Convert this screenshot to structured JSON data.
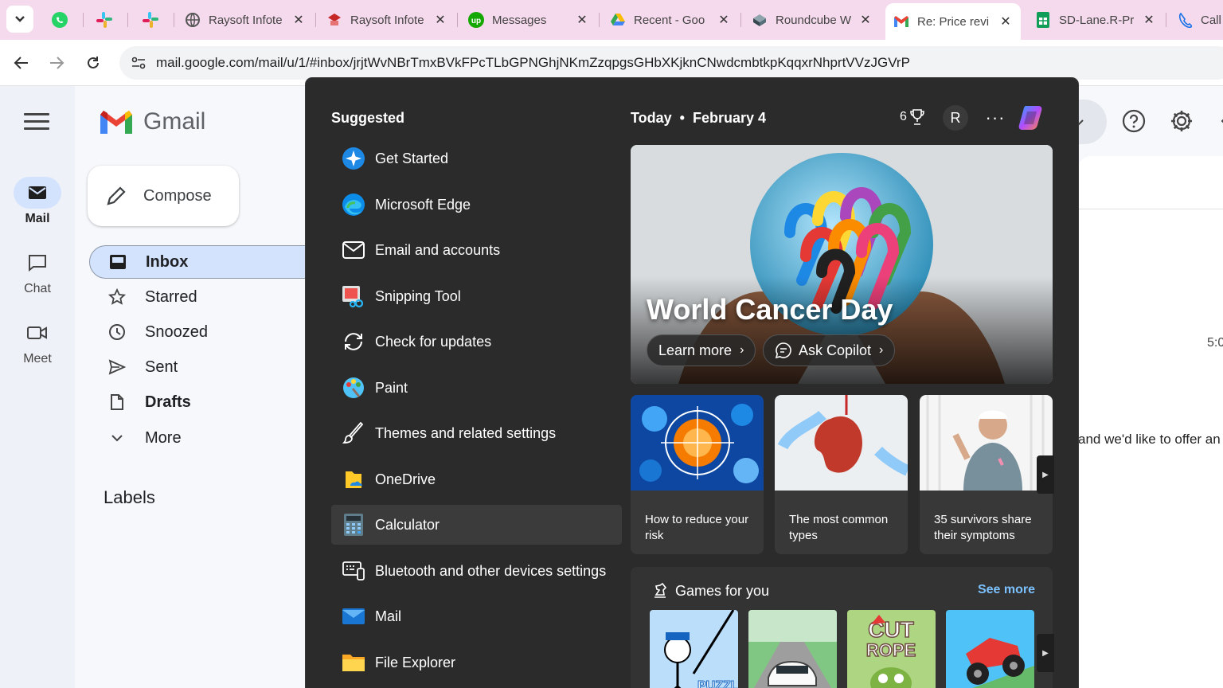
{
  "browser": {
    "tabs": [
      {
        "title": "Raysoft Infote",
        "icon": "globe-icon"
      },
      {
        "title": "Raysoft Infote",
        "icon": "raysoft-icon"
      },
      {
        "title": "Messages",
        "icon": "upwork-icon"
      },
      {
        "title": "Recent - Goo",
        "icon": "google-drive-icon"
      },
      {
        "title": "Roundcube W",
        "icon": "roundcube-icon"
      },
      {
        "title": "Re: Price revi",
        "icon": "gmail-icon",
        "active": true
      },
      {
        "title": "SD-Lane.R-Pr",
        "icon": "google-sheets-icon"
      },
      {
        "title": "Call",
        "icon": "phone-icon"
      }
    ],
    "pinned": [
      "whatsapp-icon",
      "slack-icon",
      "slack-icon"
    ],
    "url": "mail.google.com/mail/u/1/#inbox/jrjtWvNBrTmxBVkFPcTLbGPNGhjNKmZzqpgsGHbXKjknCNwdcmbtkpKqqxrNhprtVVzJGVrP"
  },
  "gmail": {
    "brand": "Gmail",
    "rail": [
      {
        "label": "Mail",
        "icon": "mail-icon",
        "active": true
      },
      {
        "label": "Chat",
        "icon": "chat-icon"
      },
      {
        "label": "Meet",
        "icon": "video-icon"
      }
    ],
    "compose_label": "Compose",
    "nav": [
      {
        "label": "Inbox",
        "icon": "inbox-icon",
        "active": true,
        "bold": true
      },
      {
        "label": "Starred",
        "icon": "star-icon"
      },
      {
        "label": "Snoozed",
        "icon": "clock-icon"
      },
      {
        "label": "Sent",
        "icon": "send-icon"
      },
      {
        "label": "Drafts",
        "icon": "file-icon",
        "bold": true
      },
      {
        "label": "More",
        "icon": "chevron-down-icon"
      }
    ],
    "labels_heading": "Labels",
    "email_time": "5:0",
    "email_snippet": "and we'd like to offer an"
  },
  "start_menu": {
    "suggested_title": "Suggested",
    "apps": [
      {
        "label": "Get Started",
        "icon": "get-started-icon"
      },
      {
        "label": "Microsoft Edge",
        "icon": "edge-icon"
      },
      {
        "label": "Email and accounts",
        "icon": "envelope-icon"
      },
      {
        "label": "Snipping Tool",
        "icon": "snipping-tool-icon"
      },
      {
        "label": "Check for updates",
        "icon": "sync-icon"
      },
      {
        "label": "Paint",
        "icon": "paint-icon"
      },
      {
        "label": "Themes and related settings",
        "icon": "brush-icon"
      },
      {
        "label": "OneDrive",
        "icon": "onedrive-icon"
      },
      {
        "label": "Calculator",
        "icon": "calculator-icon",
        "selected": true
      },
      {
        "label": "Bluetooth and other devices settings",
        "icon": "devices-icon"
      },
      {
        "label": "Mail",
        "icon": "windows-mail-icon"
      },
      {
        "label": "File Explorer",
        "icon": "folder-icon"
      }
    ],
    "today_label": "Today",
    "date": "February 4",
    "rewards_count": "6",
    "profile_initial": "R",
    "more_label": "···",
    "hero": {
      "title": "World Cancer Day",
      "learn_more": "Learn more",
      "ask_copilot": "Ask Copilot"
    },
    "cards": [
      {
        "caption": "How to reduce your risk"
      },
      {
        "caption": "The most common types"
      },
      {
        "caption": "35 survivors share their symptoms"
      }
    ],
    "games": {
      "title": "Games for you",
      "see_more": "See more",
      "tiles": [
        "Thief Puzzle",
        "Car Racing",
        "Cut the Rope",
        "Hill Climb"
      ]
    },
    "colors": {
      "panel": "#2b2b2b",
      "accent_link": "#7cc1ff",
      "selected": "#3b3b3b"
    }
  }
}
